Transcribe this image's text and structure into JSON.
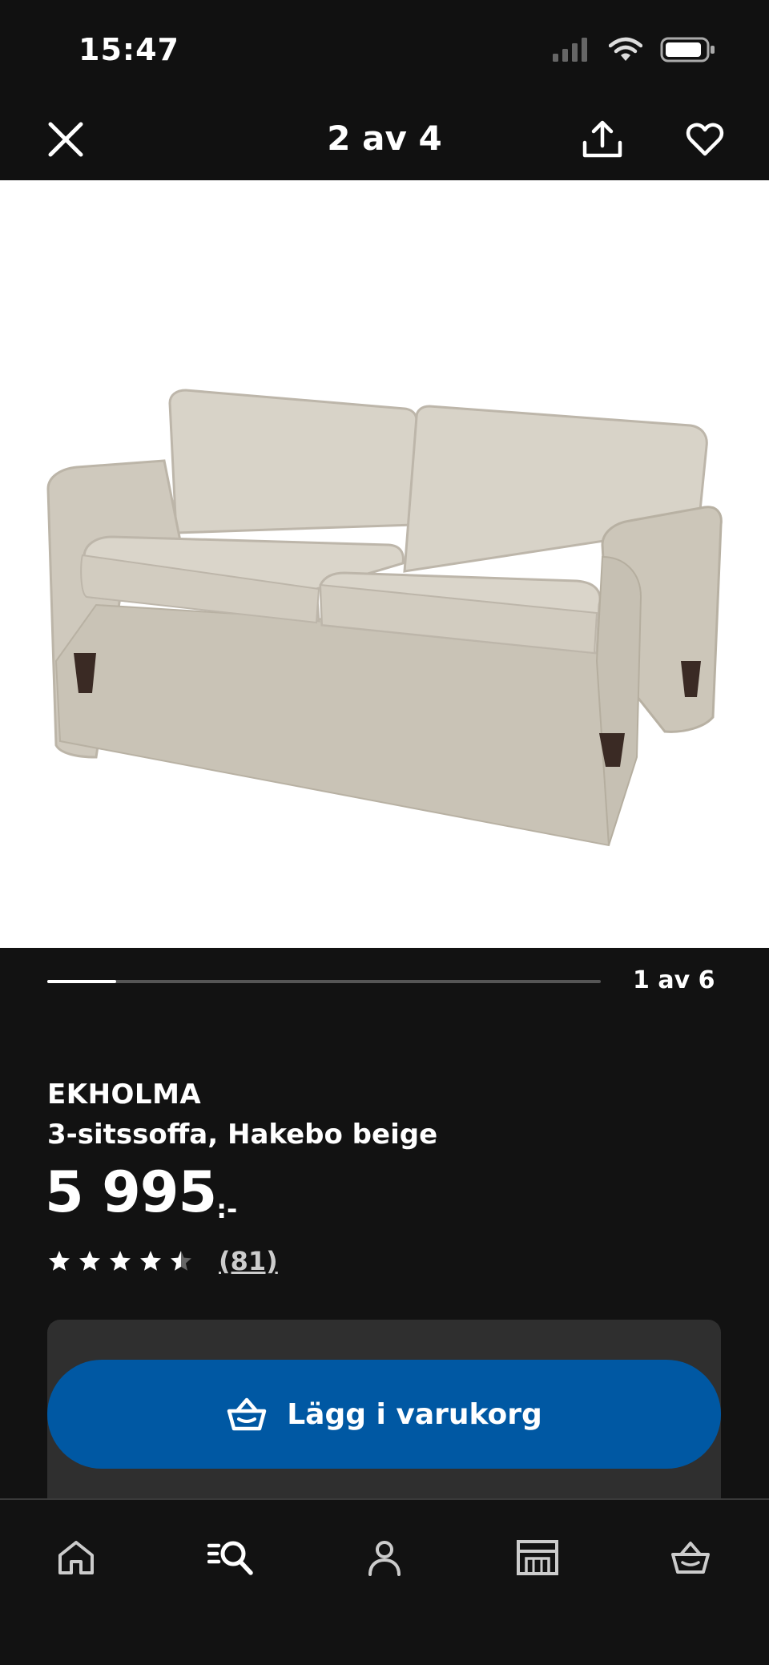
{
  "status_bar": {
    "time": "15:47"
  },
  "top_nav": {
    "counter": "2 av 4"
  },
  "gallery": {
    "counter": "1 av 6",
    "progress": 0.125
  },
  "product": {
    "name": "EKHOLMA",
    "description": "3-sitssoffa, Hakebo beige",
    "price": "5 995",
    "price_suffix": ":-",
    "rating": 4.5,
    "review_count": "(81)"
  },
  "cart": {
    "button_label": "Lägg i varukorg"
  },
  "bottom_nav": {
    "items": [
      {
        "icon": "home-icon"
      },
      {
        "icon": "search-list-icon"
      },
      {
        "icon": "profile-icon"
      },
      {
        "icon": "store-icon"
      },
      {
        "icon": "cart-basket-icon"
      }
    ]
  },
  "colors": {
    "accent_blue": "#0058a3",
    "background": "#121212",
    "panel": "#2f2f2f"
  }
}
